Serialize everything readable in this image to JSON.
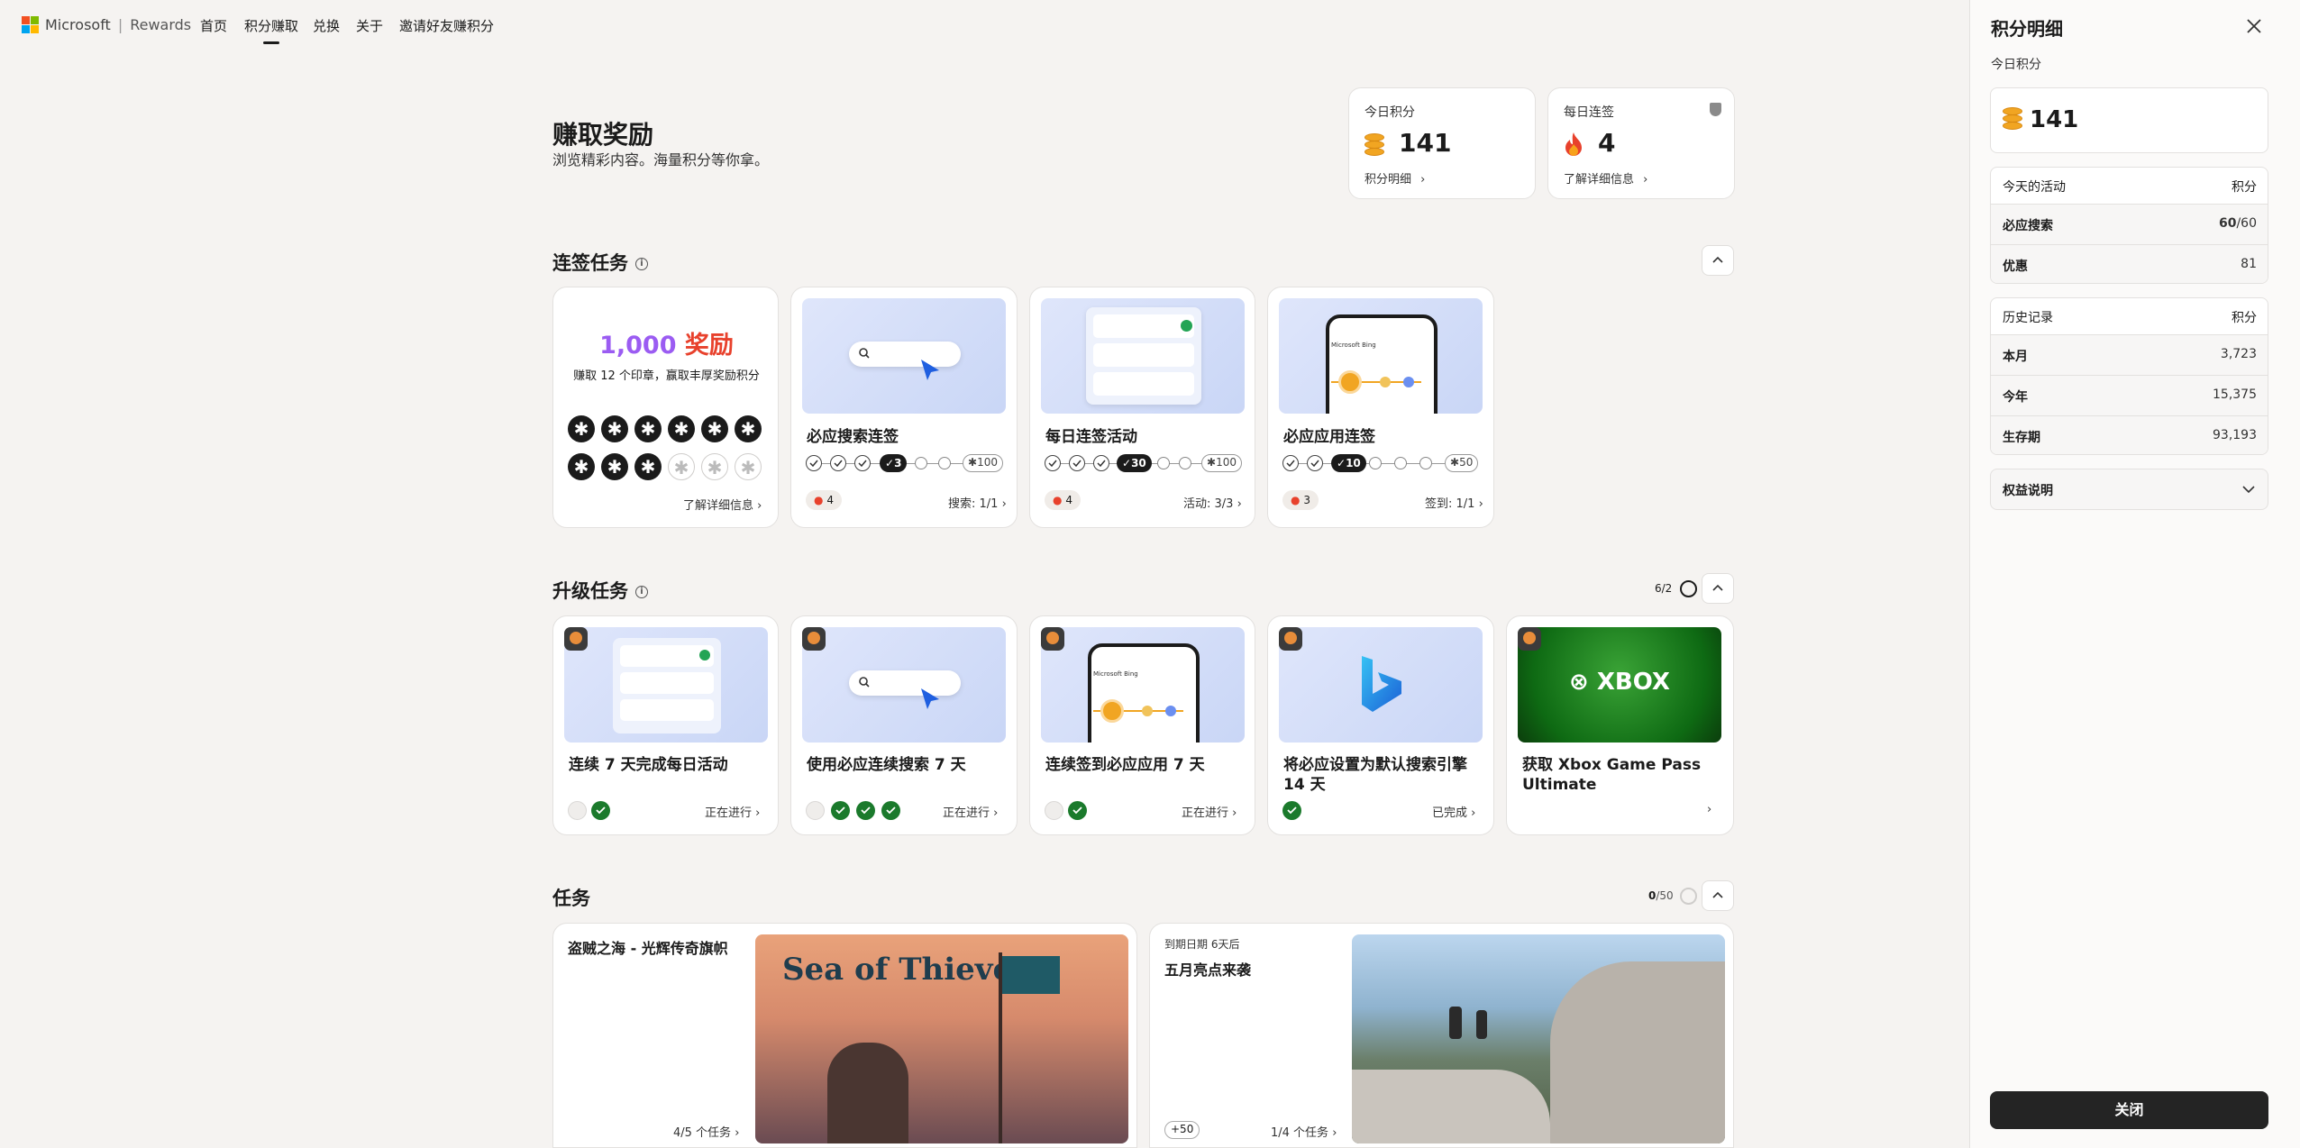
{
  "nav": {
    "brand": "Microsoft",
    "product": "Rewards",
    "items": [
      "首页",
      "积分赚取",
      "兑换",
      "关于",
      "邀请好友赚积分"
    ]
  },
  "header": {
    "title": "赚取奖励",
    "subtitle": "浏览精彩内容。海量积分等你拿。"
  },
  "today_points": {
    "label": "今日积分",
    "value": "141",
    "link": "积分明细"
  },
  "daily_streak": {
    "label": "每日连签",
    "value": "4",
    "link": "了解详细信息"
  },
  "streak_section": {
    "title": "连签任务",
    "promo": {
      "amount": "1,000",
      "reward": "奖励",
      "desc": "赚取 12 个印章，赢取丰厚奖励积分",
      "stamps_earned": 9,
      "stamps_total": 12,
      "link": "了解详细信息"
    },
    "cards": [
      {
        "title": "必应搜索连签",
        "badge": "3",
        "end": "100",
        "streak": "4",
        "progress": "搜索: 1/1"
      },
      {
        "title": "每日连签活动",
        "badge": "30",
        "end": "100",
        "streak": "4",
        "progress": "活动: 3/3"
      },
      {
        "title": "必应应用连签",
        "badge": "10",
        "end": "50",
        "streak": "3",
        "progress": "签到: 1/1"
      }
    ]
  },
  "level_section": {
    "title": "升级任务",
    "count": "6/2",
    "cards": [
      {
        "title": "连续 7 天完成每日活动",
        "status": "正在进行"
      },
      {
        "title": "使用必应连续搜索 7 天",
        "status": "正在进行"
      },
      {
        "title": "连续签到必应应用 7 天",
        "status": "正在进行"
      },
      {
        "title": "将必应设置为默认搜索引擎 14 天",
        "status": "已完成"
      },
      {
        "title": "获取 Xbox Game Pass Ultimate",
        "status": ""
      }
    ]
  },
  "tasks_section": {
    "title": "任务",
    "count_done": "0",
    "count_total": "/50",
    "cards": [
      {
        "title": "盗贼之海 - 光辉传奇旗帜",
        "progress": "4/5 个任务",
        "image_text": "Sea of Thieves"
      },
      {
        "due": "到期日期 6天后",
        "title": "五月亮点来袭",
        "bonus": "+50",
        "progress": "1/4 个任务"
      }
    ]
  },
  "panel": {
    "title": "积分明细",
    "today_label": "今日积分",
    "today_value": "141",
    "activities_header": "今天的活动",
    "points_header": "积分",
    "activities": [
      {
        "name": "必应搜索",
        "value": "60",
        "max": "/60"
      },
      {
        "name": "优惠",
        "value": "81"
      }
    ],
    "history_header": "历史记录",
    "history": [
      {
        "name": "本月",
        "value": "3,723"
      },
      {
        "name": "今年",
        "value": "15,375"
      },
      {
        "name": "生存期",
        "value": "93,193"
      }
    ],
    "benefits": "权益说明",
    "close_button": "关闭"
  },
  "colors": {
    "accent_purple": "#9b5cf2",
    "accent_red": "#e8412c",
    "green": "#1b7a2c",
    "coin": "#f1a522"
  }
}
